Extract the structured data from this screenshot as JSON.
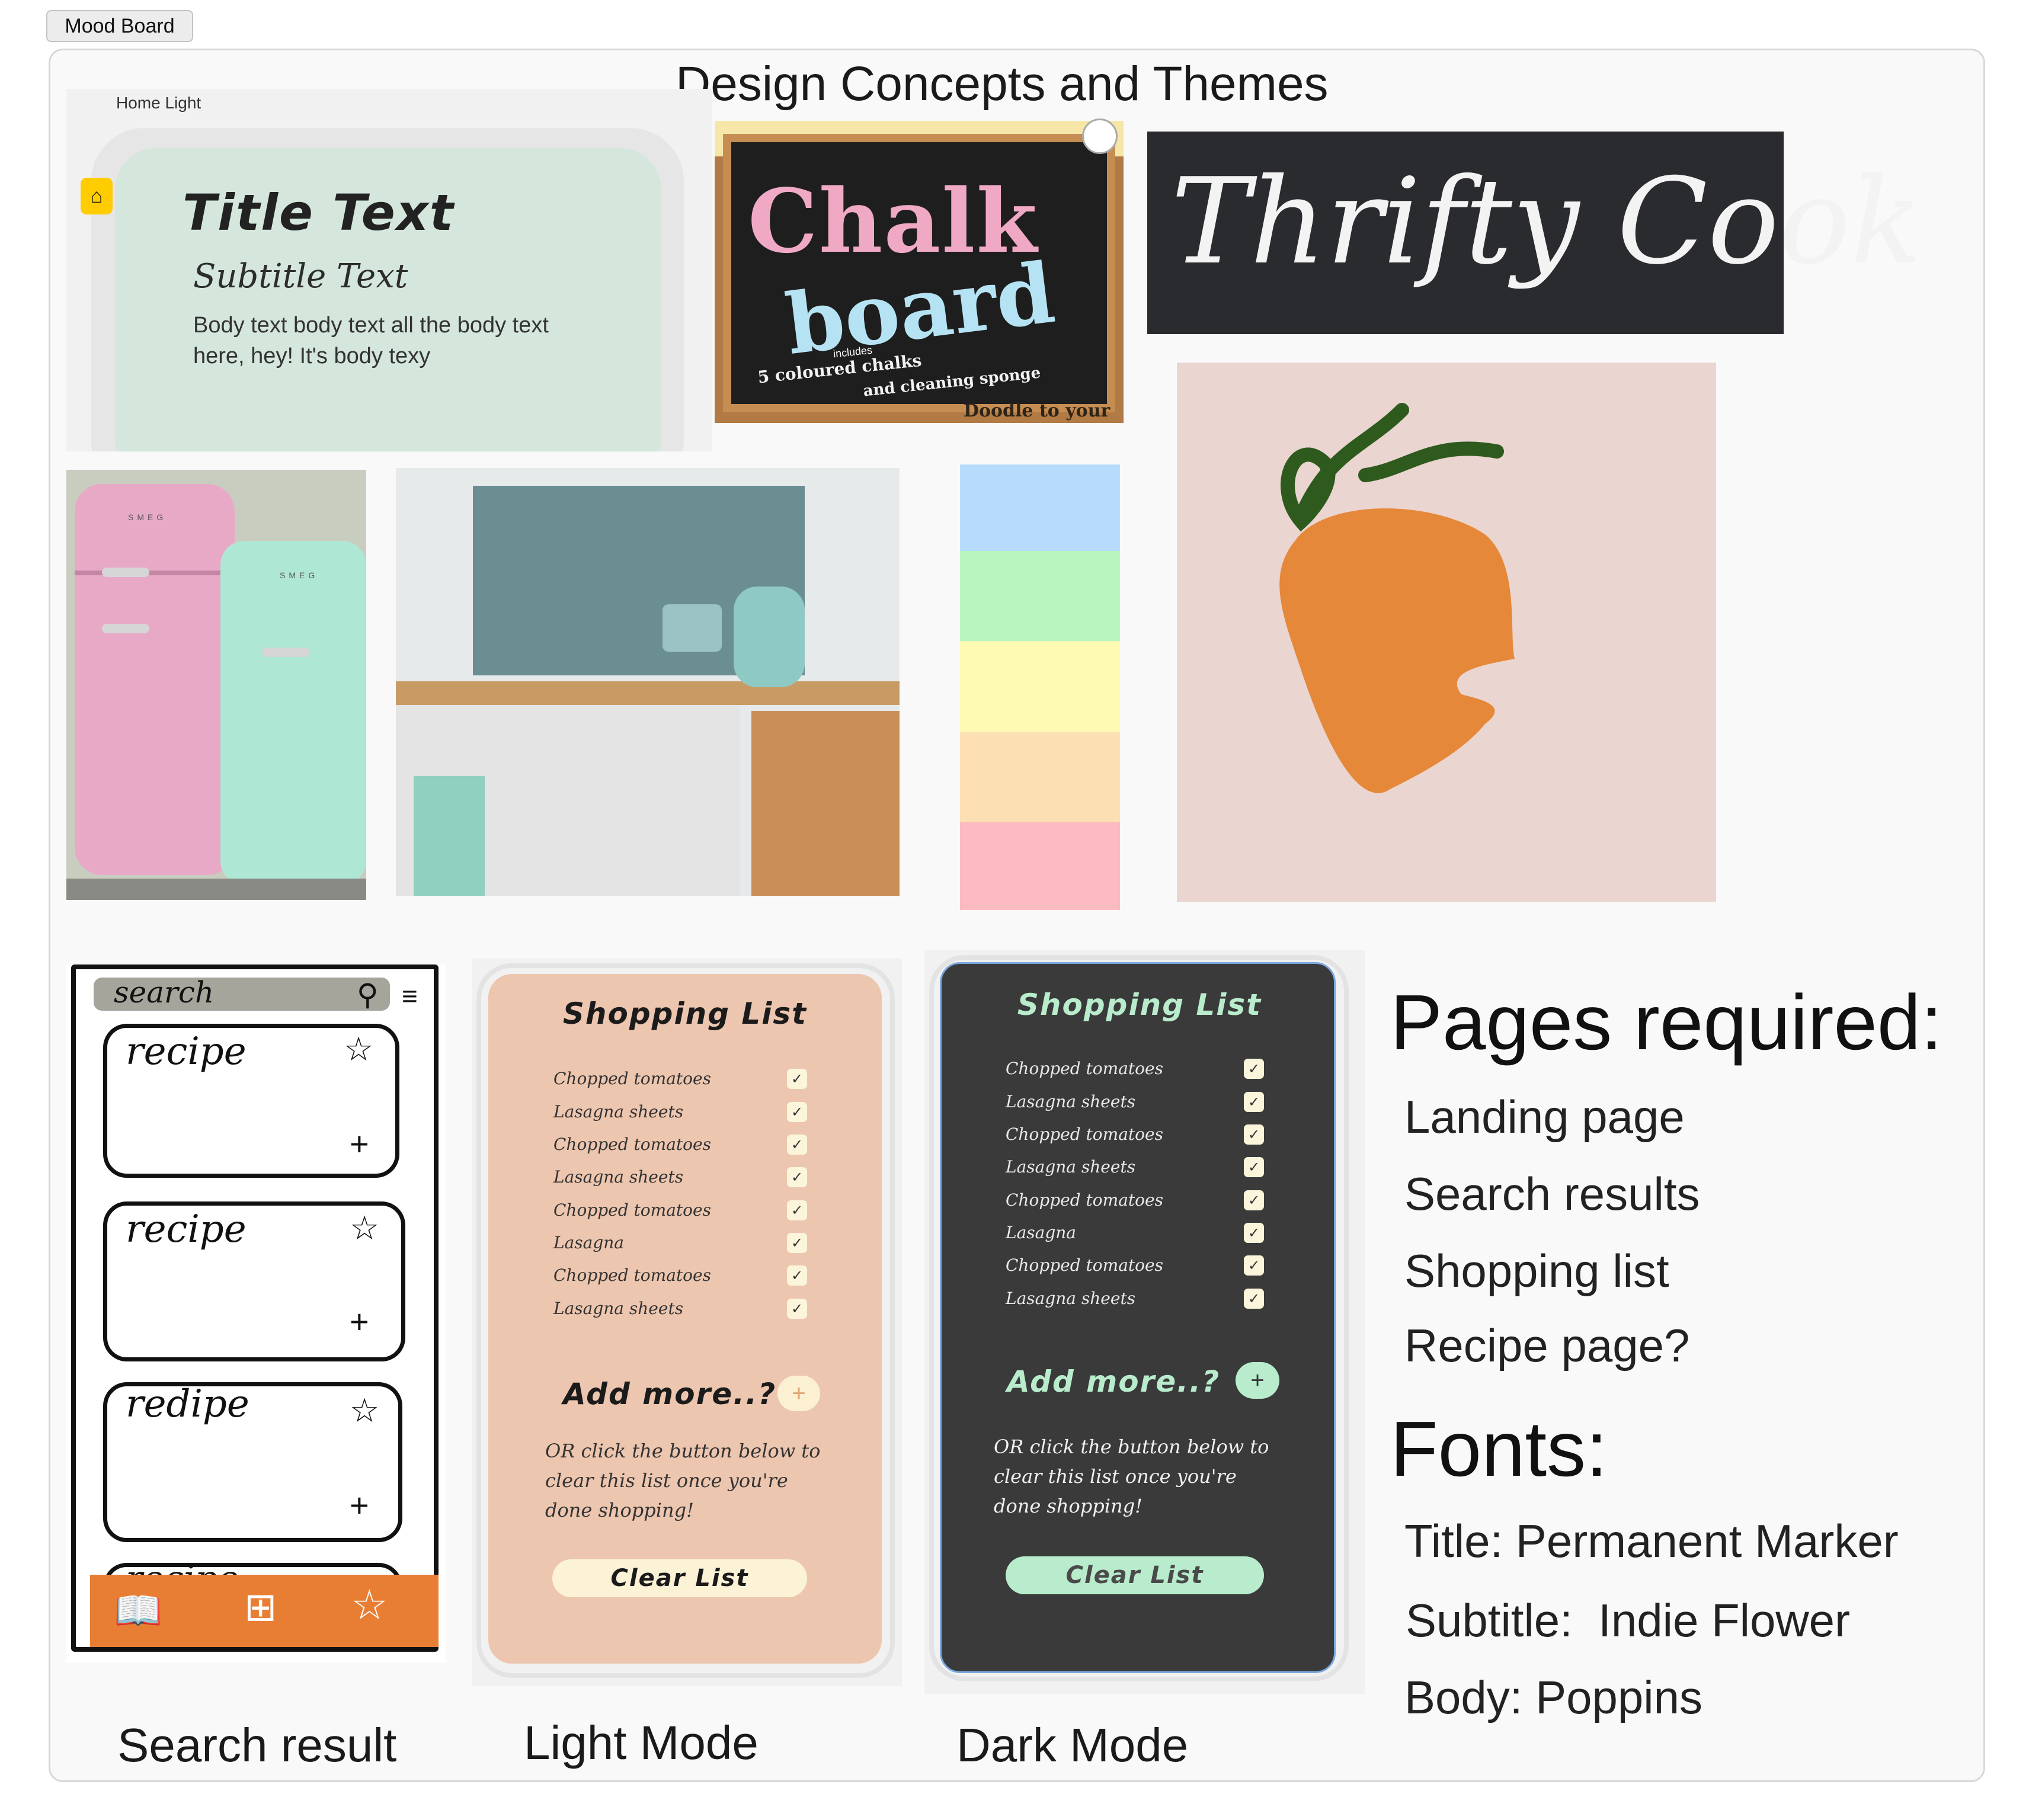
{
  "window": {
    "tab_label": "Mood Board"
  },
  "board": {
    "title": "Design Concepts and Themes"
  },
  "home_light": {
    "label": "Home Light",
    "title": "Title Text",
    "subtitle": "Subtitle Text",
    "body": "Body text body text all the body text",
    "body2": "here, hey! It's body texy"
  },
  "chalkboard": {
    "word1": "Chalk",
    "word2": "board",
    "line1": "includes",
    "line2": "5 coloured chalks",
    "line3": "and cleaning sponge",
    "line4": "Doodle to your"
  },
  "logo_text": "Thrifty Cook",
  "fridge_brand": "SMEG",
  "palette": {
    "colors": [
      "#b7dcfb",
      "#b8f5bf",
      "#fefab4",
      "#fddfb4",
      "#fcbac1"
    ]
  },
  "sketch": {
    "search": "search",
    "cards": [
      "recipe",
      "recipe",
      "redipe",
      "recipe"
    ]
  },
  "light_mode": {
    "title": "Shopping List",
    "items": [
      "Chopped tomatoes",
      "Lasagna sheets",
      "Chopped tomatoes",
      "Lasagna sheets",
      "Chopped tomatoes",
      "Lasagna",
      "Chopped tomatoes",
      "Lasagna sheets"
    ],
    "add_more": "Add more..?",
    "plus": "+",
    "note1": "OR click the button below to",
    "note2": "clear this list once you're",
    "note3": "done shopping!",
    "clear": "Clear List"
  },
  "dark_mode": {
    "title": "Shopping List",
    "items": [
      "Chopped tomatoes",
      "Lasagna sheets",
      "Chopped tomatoes",
      "Lasagna sheets",
      "Chopped tomatoes",
      "Lasagna",
      "Chopped tomatoes",
      "Lasagna sheets"
    ],
    "add_more": "Add more..?",
    "plus": "+",
    "note1": "OR click the button below to",
    "note2": "clear this list once you're",
    "note3": "done shopping!",
    "clear": "Clear List"
  },
  "captions": {
    "search": "Search result",
    "light": "Light Mode",
    "dark": "Dark Mode"
  },
  "pages_required": {
    "heading": "Pages required:",
    "items": [
      "Landing page",
      "Search results",
      "Shopping list",
      "Recipe page?"
    ]
  },
  "fonts": {
    "heading": "Fonts:",
    "title": "Title: Permanent Marker",
    "subtitle": "Subtitle:  Indie Flower",
    "body": "Body: Poppins"
  },
  "colors": {
    "light_bg": "#edc6af",
    "dark_bg": "#3a3a3a",
    "mint": "#b8eccc",
    "carrot": "#e5883a",
    "stem": "#2f5a1e",
    "sketch_bar": "#e87e33"
  }
}
